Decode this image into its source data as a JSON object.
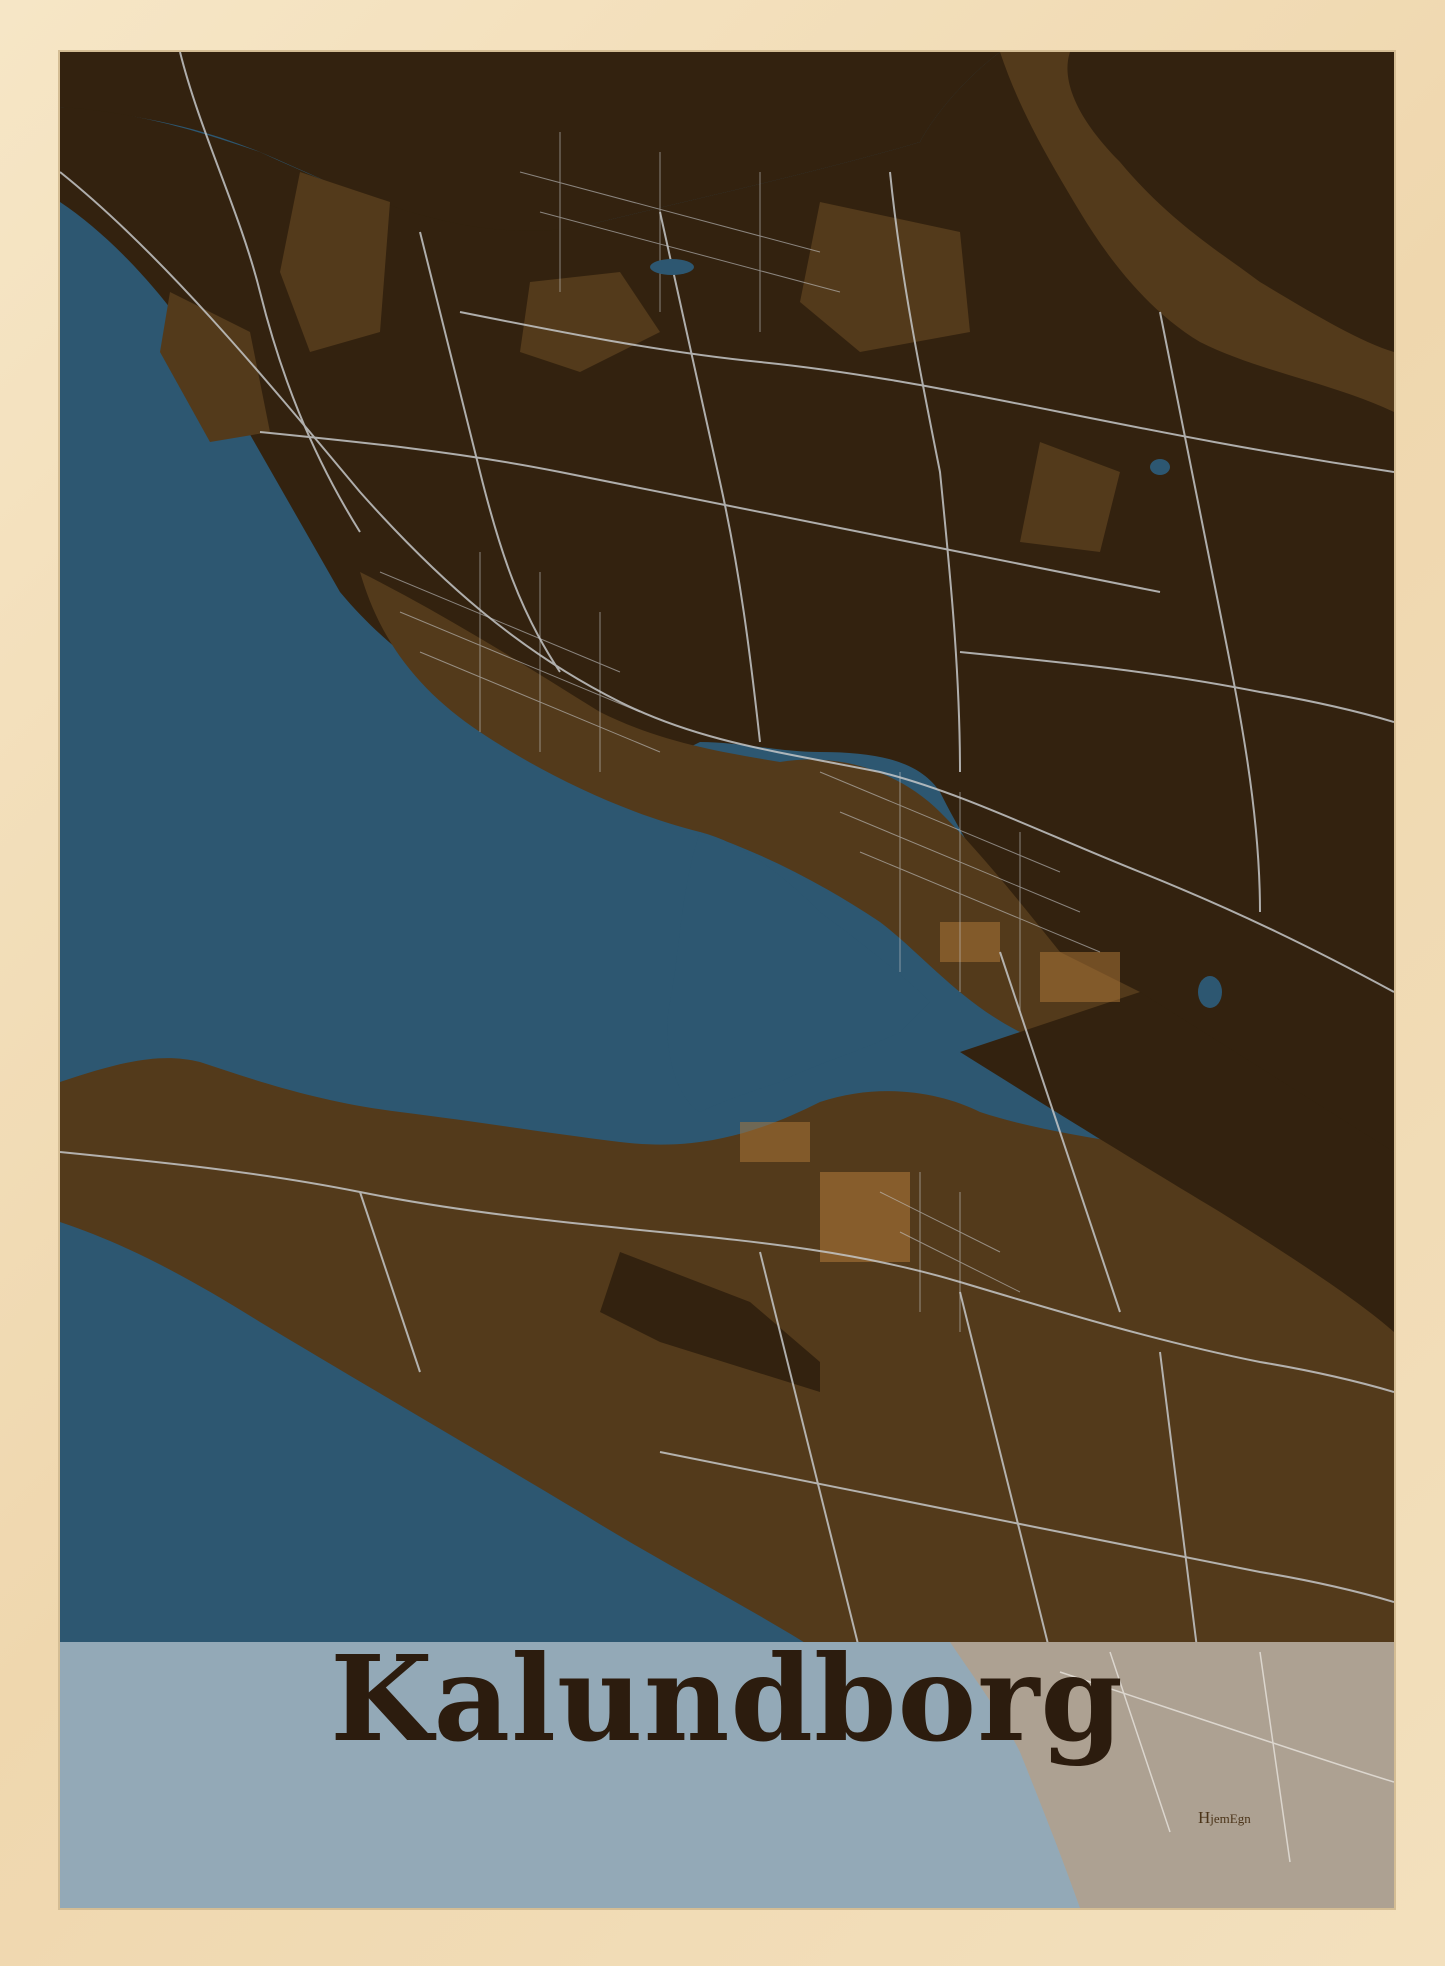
{
  "poster": {
    "city": "Kalundborg",
    "brand_initial": "H",
    "brand_rest": "jemEgn"
  },
  "colors": {
    "frame": "#f3e0bd",
    "water": "#2d5771",
    "land_dark": "#33220f",
    "land_mid": "#533a1b",
    "land_patch": "#6f4f22",
    "roads": "#c5c7c8",
    "title_band": "#93a9b7",
    "title_band_land": "#ada192",
    "title_text": "#2c1c0e",
    "industrial": "#b27a3a"
  },
  "map": {
    "style": "dark brown land, steel blue water, grey roads",
    "icons": [
      "road-network",
      "harbor",
      "peninsula"
    ]
  }
}
